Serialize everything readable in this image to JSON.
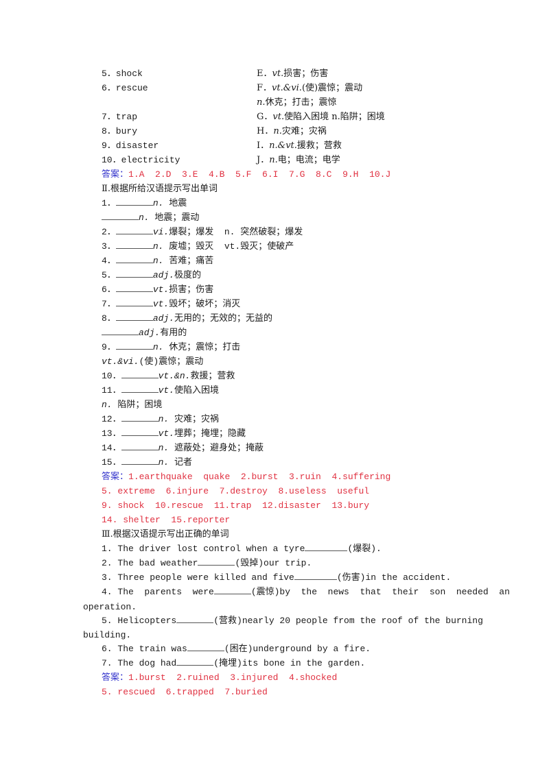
{
  "section1": {
    "left": [
      "5．shock",
      "6．rescue",
      "7．trap",
      "8．bury",
      "9．disaster",
      "10．electricity"
    ],
    "right": [
      {
        "letter": "E．",
        "pos": "vt.",
        "text": "损害；伤害"
      },
      {
        "letter": "F．",
        "pos": "vt.&vi.",
        "text": "(使)震惊；震动"
      },
      {
        "letter": "",
        "pos": "n.",
        "text": "休克；打击；震惊"
      },
      {
        "letter": "G．",
        "pos": "vt.",
        "text": "使陷入困境 n.陷阱；困境"
      },
      {
        "letter": "H．",
        "pos": "n.",
        "text": "灾难；灾祸"
      },
      {
        "letter": "I．",
        "pos": "n.&vt.",
        "text": "援救；营救"
      },
      {
        "letter": "J．",
        "pos": "n.",
        "text": "电；电流；电学"
      }
    ],
    "answer_label": "答案：",
    "answer": "1.A  2.D  3.E  4.B  5.F  6.I  7.G  8.C  9.H  10.J"
  },
  "section2": {
    "heading": "Ⅱ.根据所给汉语提示写出单词",
    "items": [
      {
        "num": "1．",
        "pos": "n.",
        "text": " 地震"
      },
      {
        "num": "",
        "pos": "n.",
        "text": " 地震；震动"
      },
      {
        "num": "2．",
        "pos": "vi.",
        "text": "爆裂；爆发  n. 突然破裂；爆发"
      },
      {
        "num": "3．",
        "pos": "n.",
        "text": " 废墟；毁灭  vt.毁灭；使破产"
      },
      {
        "num": "4．",
        "pos": "n.",
        "text": " 苦难；痛苦"
      },
      {
        "num": "5．",
        "pos": "adj.",
        "text": "极度的"
      },
      {
        "num": "6．",
        "pos": "vt.",
        "text": "损害；伤害"
      },
      {
        "num": "7．",
        "pos": "vt.",
        "text": "毁坏；破坏；消灭"
      },
      {
        "num": "8．",
        "pos": "adj.",
        "text": "无用的；无效的；无益的"
      },
      {
        "num": "",
        "pos": "adj.",
        "text": "有用的"
      },
      {
        "num": "9．",
        "pos": "n.",
        "text": " 休克；震惊；打击"
      },
      {
        "num": "vt.&vi.",
        "pos": "",
        "text": "(使)震惊；震动"
      },
      {
        "num": "10．",
        "pos": "vt.&n.",
        "text": "救援；营救"
      },
      {
        "num": "11．",
        "pos": "vt.",
        "text": "使陷入困境"
      },
      {
        "num": "n.",
        "pos": "",
        "text": " 陷阱；困境"
      },
      {
        "num": "12．",
        "pos": "n.",
        "text": " 灾难；灾祸"
      },
      {
        "num": "13．",
        "pos": "vt.",
        "text": "埋葬；掩埋；隐藏"
      },
      {
        "num": "14．",
        "pos": "n.",
        "text": " 遮蔽处；避身处；掩蔽"
      },
      {
        "num": "15．",
        "pos": "n.",
        "text": " 记者"
      }
    ],
    "answer_label": "答案：",
    "answers": [
      "1.earthquake  quake  2.burst  3.ruin  4.suffering",
      "5. extreme  6.injure  7.destroy  8.useless  useful",
      "9. shock  10.rescue  11.trap  12.disaster  13.bury",
      "14. shelter  15.reporter"
    ]
  },
  "section3": {
    "heading": "Ⅲ.根据汉语提示写出正确的单词",
    "items": [
      {
        "before": "1. The driver lost control when a tyre",
        "after": "(爆裂)."
      },
      {
        "before": "2. The bad weather",
        "after": "(毁掉)our trip."
      },
      {
        "before": "3. Three people were killed and five",
        "after": "(伤害)in the accident."
      },
      {
        "before": "4. The  parents  were",
        "after": "(震惊)by  the  news  that  their  son  needed  an"
      },
      {
        "before": "5. Helicopters",
        "after": "(营救)nearly 20 people from the roof of the burning"
      },
      {
        "before": "6. The train was",
        "after": "(困在)underground by a fire."
      },
      {
        "before": "7. The dog had",
        "after": "(掩埋)its bone in the garden."
      }
    ],
    "continuations": [
      "operation.",
      "building."
    ],
    "answer_label": "答案：",
    "answers": [
      "1.burst  2.ruined  3.injured  4.shocked",
      "5. rescued  6.trapped  7.buried"
    ]
  }
}
